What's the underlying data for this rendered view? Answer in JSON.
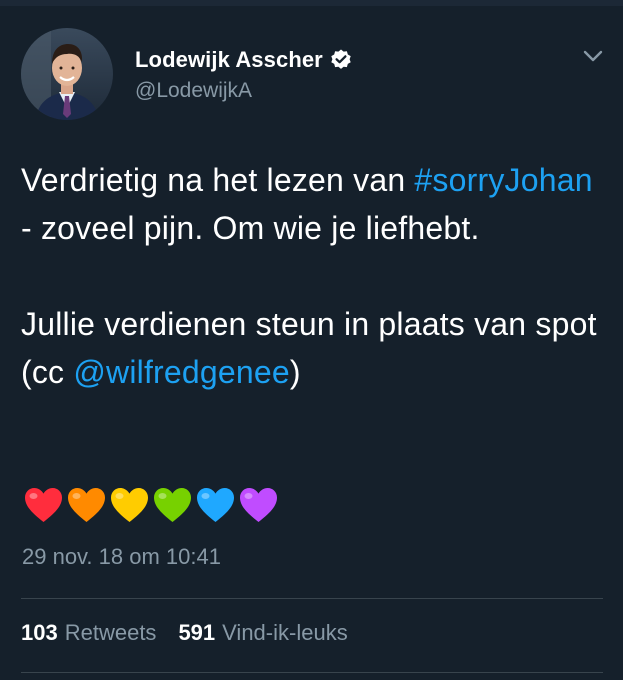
{
  "user": {
    "name": "Lodewijk Asscher",
    "handle": "@LodewijkA"
  },
  "tweet": {
    "text_part1": "Verdrietig na het lezen van ",
    "hashtag": "#sorryJohan",
    "text_part2": " - zoveel pijn. Om wie je liefhebt.",
    "text_part3": "Jullie verdienen steun in plaats van spot (cc ",
    "mention": "@wilfredgenee",
    "text_part4": ")",
    "timestamp": "29 nov. 18 om 10:41"
  },
  "hearts": [
    {
      "name": "red-heart-icon",
      "color": "#ff2d3d"
    },
    {
      "name": "orange-heart-icon",
      "color": "#ff8a00"
    },
    {
      "name": "yellow-heart-icon",
      "color": "#ffcc00"
    },
    {
      "name": "green-heart-icon",
      "color": "#77d100"
    },
    {
      "name": "blue-heart-icon",
      "color": "#1fa8ff"
    },
    {
      "name": "purple-heart-icon",
      "color": "#c04cff"
    }
  ],
  "stats": {
    "retweets_count": "103",
    "retweets_label": "Retweets",
    "likes_count": "591",
    "likes_label": "Vind-ik-leuks"
  },
  "colors": {
    "background": "#15202b",
    "link": "#1da1f2",
    "secondary_text": "#8899a6",
    "divider": "#38444d"
  }
}
